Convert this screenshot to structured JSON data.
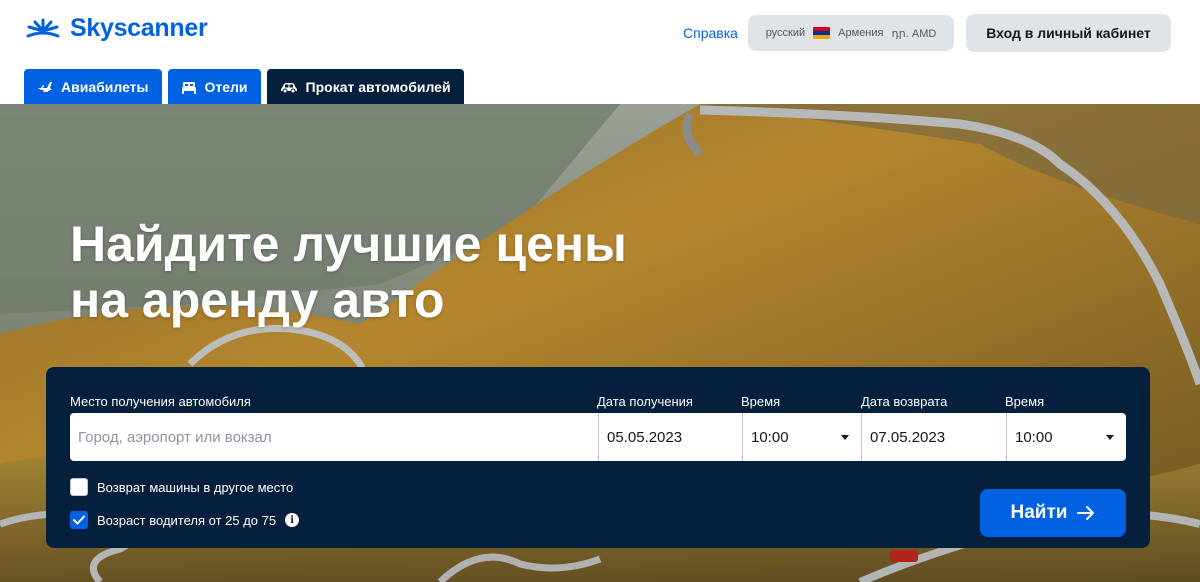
{
  "header": {
    "logo_text": "Skyscanner",
    "help_link": "Справка",
    "locale": {
      "language": "русский",
      "country": "Армения",
      "currency": "դր. AMD",
      "flag_colors": [
        "#d90012",
        "#0033a0",
        "#f2a800"
      ]
    },
    "login_label": "Вход в личный кабинет"
  },
  "tabs": [
    {
      "label": "Авиабилеты",
      "icon": "plane-icon",
      "active": false
    },
    {
      "label": "Отели",
      "icon": "bed-icon",
      "active": false
    },
    {
      "label": "Прокат автомобилей",
      "icon": "car-icon",
      "active": true
    }
  ],
  "hero": {
    "headline_line1": "Найдите лучшие цены",
    "headline_line2": "на аренду авто"
  },
  "search": {
    "pickup_location_label": "Место получения автомобиля",
    "pickup_location_placeholder": "Город, аэропорт или вокзал",
    "pickup_date_label": "Дата получения",
    "pickup_date_value": "05.05.2023",
    "pickup_time_label": "Время",
    "pickup_time_value": "10:00",
    "return_date_label": "Дата возврата",
    "return_date_value": "07.05.2023",
    "return_time_label": "Время",
    "return_time_value": "10:00",
    "different_return_label": "Возврат машины в другое место",
    "different_return_checked": false,
    "driver_age_label": "Возраст водителя от 25 до 75",
    "driver_age_checked": true,
    "search_button_label": "Найти"
  },
  "colors": {
    "brand_blue": "#0062e3",
    "panel_navy": "#05203c"
  }
}
